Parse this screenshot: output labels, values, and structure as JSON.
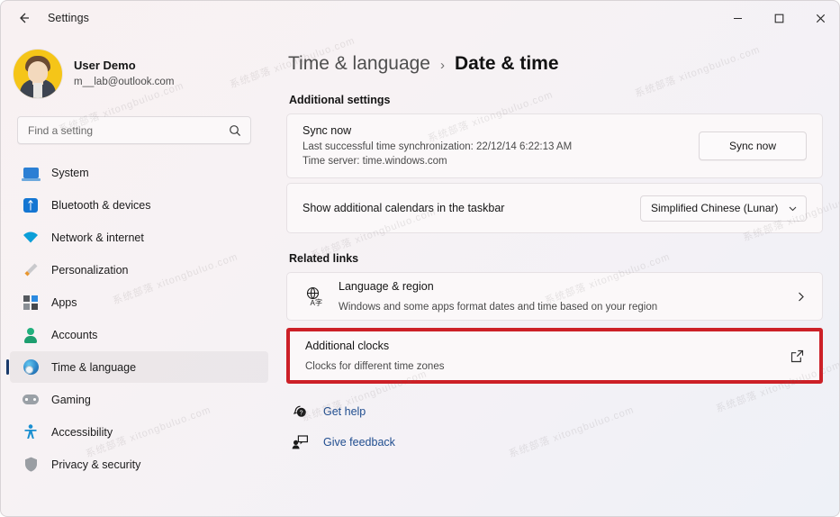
{
  "titlebar": {
    "back_icon": "back-arrow-icon",
    "title": "Settings",
    "minimize": "minimize-icon",
    "maximize": "maximize-icon",
    "close": "close-icon"
  },
  "sidebar": {
    "profile": {
      "name": "User Demo",
      "email": "m__lab@outlook.com"
    },
    "search": {
      "placeholder": "Find a setting",
      "value": "",
      "icon": "search-icon"
    },
    "items": [
      {
        "label": "System",
        "icon": "system-icon",
        "selected": false
      },
      {
        "label": "Bluetooth & devices",
        "icon": "bluetooth-icon",
        "selected": false
      },
      {
        "label": "Network & internet",
        "icon": "wifi-icon",
        "selected": false
      },
      {
        "label": "Personalization",
        "icon": "brush-icon",
        "selected": false
      },
      {
        "label": "Apps",
        "icon": "apps-icon",
        "selected": false
      },
      {
        "label": "Accounts",
        "icon": "account-icon",
        "selected": false
      },
      {
        "label": "Time & language",
        "icon": "clock-globe-icon",
        "selected": true
      },
      {
        "label": "Gaming",
        "icon": "gamepad-icon",
        "selected": false
      },
      {
        "label": "Accessibility",
        "icon": "accessibility-icon",
        "selected": false
      },
      {
        "label": "Privacy & security",
        "icon": "shield-icon",
        "selected": false
      }
    ]
  },
  "content": {
    "breadcrumb": {
      "parent": "Time & language",
      "separator": "›",
      "current": "Date & time"
    },
    "additional_settings": {
      "heading": "Additional settings",
      "sync": {
        "title": "Sync now",
        "last_sync": "Last successful time synchronization: 22/12/14 6:22:13 AM",
        "time_server": "Time server: time.windows.com",
        "button_label": "Sync now"
      },
      "calendars": {
        "label": "Show additional calendars in the taskbar",
        "selected_option": "Simplified Chinese (Lunar)",
        "chevron_icon": "chevron-down-icon"
      }
    },
    "related_links": {
      "heading": "Related links",
      "items": [
        {
          "title": "Language & region",
          "subtitle": "Windows and some apps format dates and time based on your region",
          "icon": "language-globe-icon",
          "action_icon": "chevron-right-icon",
          "highlighted": false
        },
        {
          "title": "Additional clocks",
          "subtitle": "Clocks for different time zones",
          "icon": "",
          "action_icon": "external-link-icon",
          "highlighted": true
        }
      ]
    },
    "help_links": [
      {
        "label": "Get help",
        "icon": "help-question-icon"
      },
      {
        "label": "Give feedback",
        "icon": "feedback-icon"
      }
    ]
  },
  "colors": {
    "highlight_border": "#cc2027",
    "link_text": "#1f4d8f",
    "accent_indicator": "#1a3a6b"
  },
  "watermarks": [
    "系统部落 xitongbuluo.com",
    "系统部落 xitongbuluo.com",
    "系统部落 xitongbuluo.com",
    "系统部落 xitongbuluo.com",
    "系统部落 xitongbuluo.com",
    "系统部落 xitongbuluo.com",
    "系统部落 xitongbuluo.com",
    "系统部落 xitongbuluo.com",
    "系统部落 xitongbuluo.com",
    "系统部落 xitongbuluo.com",
    "系统部落 xitongbuluo.com",
    "系统部落 xitongbuluo.com"
  ]
}
